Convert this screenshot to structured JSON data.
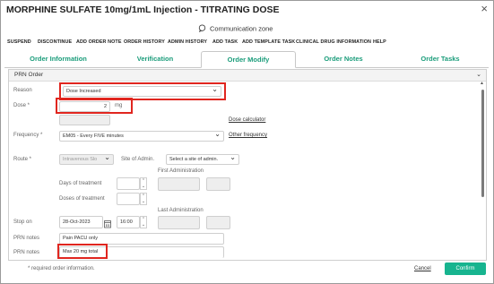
{
  "window": {
    "title": "MORPHINE SULFATE 10mg/1mL Injection - TITRATING DOSE",
    "close_glyph": "×",
    "communication_zone": "Communication zone"
  },
  "menu": [
    "SUSPEND",
    "DISCONTINUE",
    "ADD ORDER NOTE",
    "ORDER HISTORY",
    "ADMIN HISTORY",
    "ADD TASK",
    "ADD TEMPLATE TASK",
    "CLINICAL DRUG INFORMATION",
    "HELP"
  ],
  "tabs": {
    "order_information": "Order Information",
    "verification": "Verification",
    "order_modify": "Order Modify",
    "order_notes": "Order Notes",
    "order_tasks": "Order Tasks",
    "active": "Order Modify"
  },
  "panel": {
    "header": "PRN Order"
  },
  "form": {
    "reason_label": "Reason",
    "reason_value": "Dose Increased",
    "dose_label": "Dose *",
    "dose_value": "2",
    "dose_unit": "mg",
    "dose_calculator_link": "Dose calculator",
    "frequency_label": "Frequency *",
    "frequency_value": "EM05 - Every FIVE minutes",
    "other_frequency_link": "Other frequency",
    "route_label": "Route *",
    "route_value": "Intravenous Slo",
    "site_label": "Site of Admin.",
    "site_placeholder": "Select a site of admin.",
    "first_admin_label": "First Administration",
    "days_label": "Days of treatment",
    "doses_label": "Doses of treatment",
    "last_admin_label": "Last Administration",
    "stop_label": "Stop on",
    "stop_date": "28-Oct-2023",
    "stop_time": "16:00",
    "prn_notes_label_1": "PRN notes",
    "prn_notes_value_1": "Pain PACU only",
    "prn_notes_label_2": "PRN notes",
    "prn_notes_value_2": "Max 20 mg total"
  },
  "footer": {
    "required_note": "* required order information.",
    "cancel": "Cancel",
    "confirm": "Confirm"
  },
  "colors": {
    "accent": "#17b48f",
    "tab_text": "#1a9c7a",
    "highlight": "#e0261f"
  }
}
